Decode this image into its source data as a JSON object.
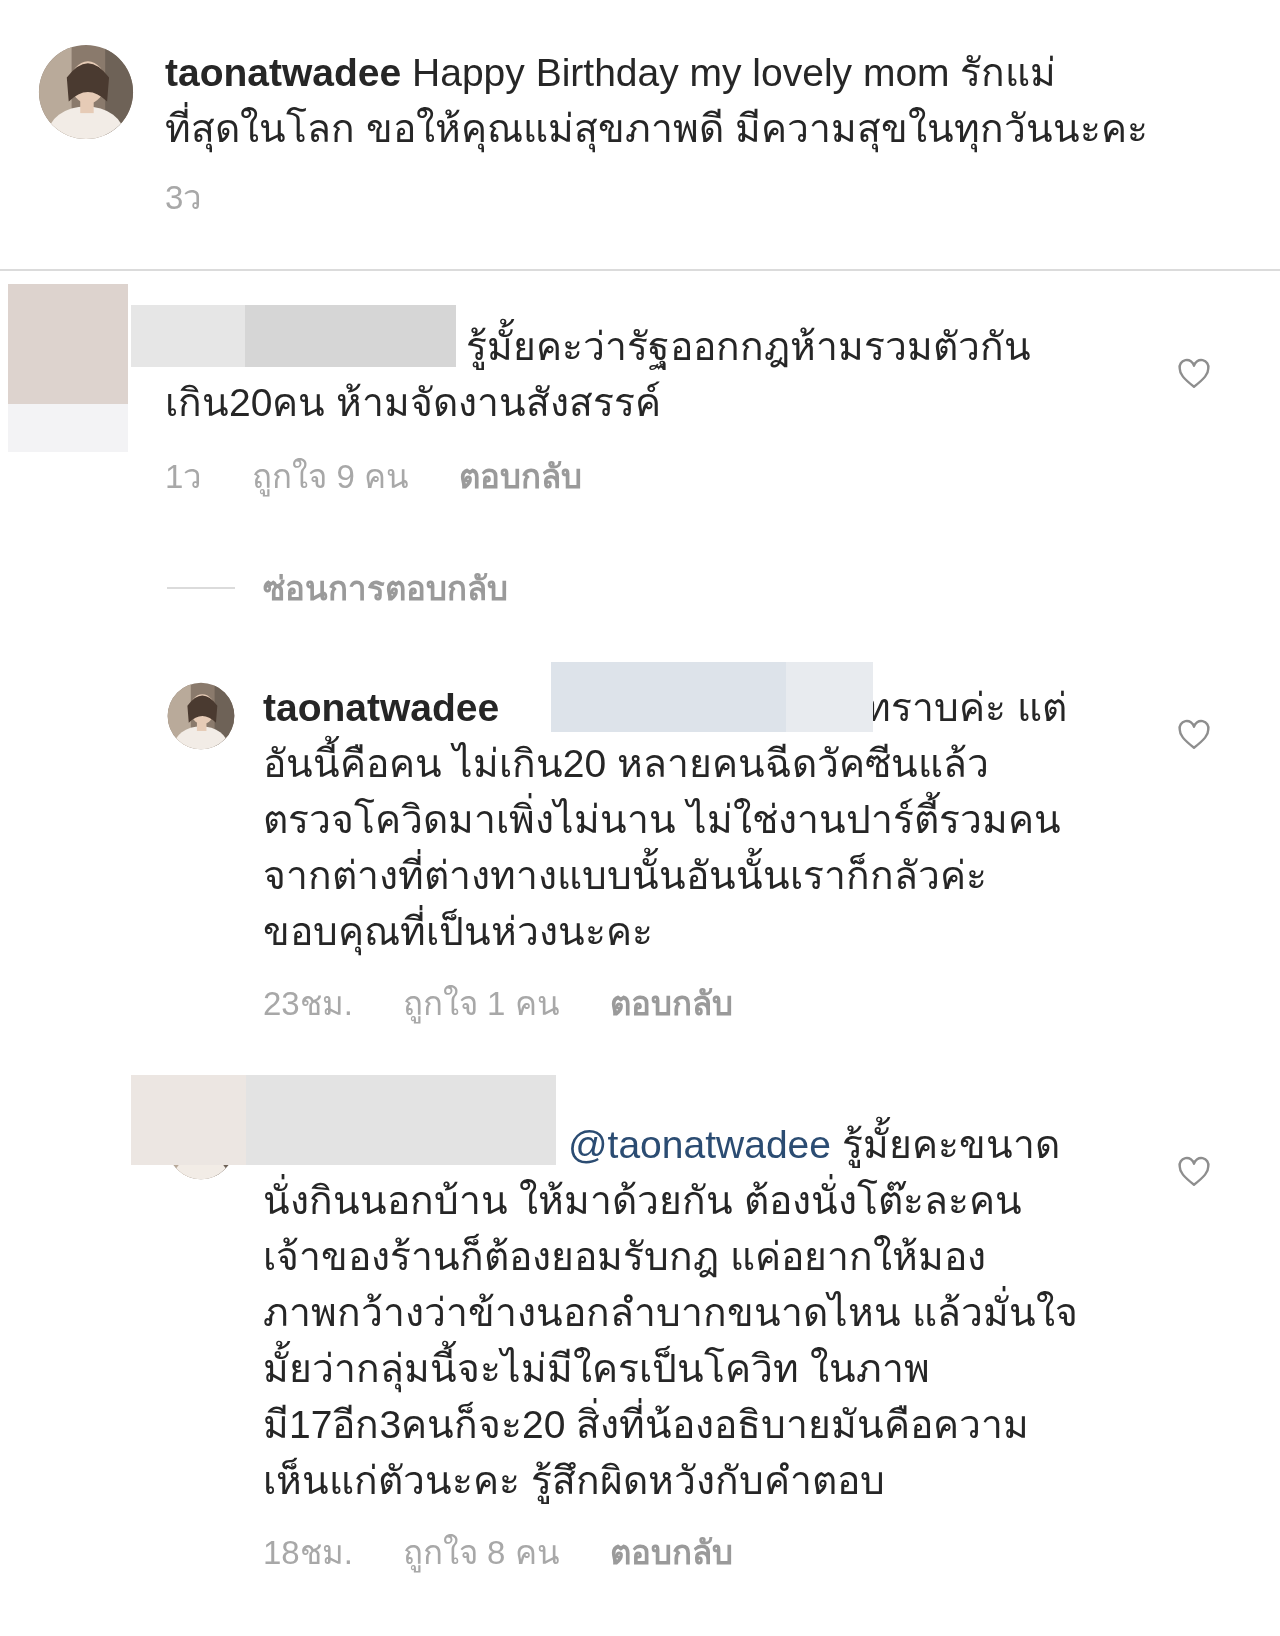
{
  "caption": {
    "username": "taonatwadee",
    "lines": [
      "Happy Birthday my lovely mom รักแม่",
      "ที่สุดในโลก ขอให้คุณแม่สุขภาพดี มีความสุขในทุกวันนะคะ"
    ],
    "time": "3ว"
  },
  "comment": {
    "name_redacted": true,
    "lines": [
      "รู้มั้ยคะว่ารัฐออกกฎห้ามรวมตัวกัน",
      "เกิน20คน ห้ามจัดงานสังสรรค์"
    ],
    "time": "1ว",
    "likes": "ถูกใจ 9 คน",
    "reply_label": "ตอบกลับ",
    "liked": false
  },
  "hide_replies": "ซ่อนการตอบกลับ",
  "replies": [
    {
      "username": "taonatwadee",
      "mention_redacted": true,
      "lines": [
        "ทราบค่ะ แต่",
        "อันนี้คือคน ไม่เกิน20 หลายคนฉีดวัคซีนแล้ว",
        "ตรวจโควิดมาเพิ่งไม่นาน ไม่ใช่งานปาร์ตี้รวมคน",
        "จากต่างที่ต่างทางแบบนั้นอันนั้นเราก็กลัวค่ะ",
        "ขอบคุณที่เป็นห่วงนะคะ"
      ],
      "time": "23ชม.",
      "likes": "ถูกใจ 1 คน",
      "reply_label": "ตอบกลับ",
      "liked": false
    },
    {
      "name_redacted": true,
      "mention": "@taonatwadee",
      "lines": [
        "รู้มั้ยคะขนาด",
        "นั่งกินนอกบ้าน  ให้มาด้วยกัน ต้องนั่งโต๊ะละคน",
        "เจ้าของร้านก็ต้องยอมรับกฎ  แค่อยากให้มอง",
        "ภาพกว้างว่าข้างนอกลำบากขนาดไหน แล้วมั่นใจ",
        "มั้ยว่ากลุ่มนี้จะไม่มีใครเป็นโควิท ในภาพ",
        "มี17อีก3คนก็จะ20 สิ่งที่น้องอธิบายมันคือความ",
        "เห็นแก่ตัวนะคะ  รู้สึกผิดหวังกับคำตอบ"
      ],
      "time": "18ชม.",
      "likes": "ถูกใจ 8 คน",
      "reply_label": "ตอบกลับ",
      "liked": false
    }
  ]
}
